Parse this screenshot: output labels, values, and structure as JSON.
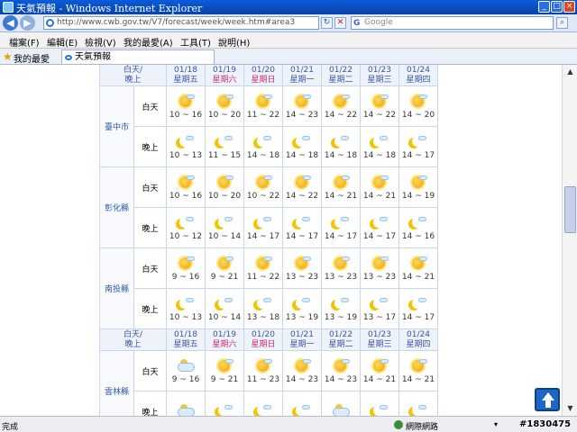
{
  "window": {
    "title": "天氣預報 - Windows Internet Explorer",
    "minimize": "_",
    "maximize": "□",
    "close": "×"
  },
  "address": {
    "url": "http://www.cwb.gov.tw/V7/forecast/week/week.htm#area3",
    "search_placeholder": "Google",
    "search_brand": "G"
  },
  "menu": [
    "檔案(F)",
    "編輯(E)",
    "檢視(V)",
    "我的最愛(A)",
    "工具(T)",
    "說明(H)"
  ],
  "favorites": {
    "label": "我的最愛",
    "tab": "天氣預報"
  },
  "table": {
    "corner_label": [
      "白天/",
      "晚上"
    ],
    "header": [
      {
        "date": "01/18",
        "weekday": "星期五",
        "weekend": false
      },
      {
        "date": "01/19",
        "weekday": "星期六",
        "weekend": true
      },
      {
        "date": "01/20",
        "weekday": "星期日",
        "weekend": true
      },
      {
        "date": "01/21",
        "weekday": "星期一",
        "weekend": false
      },
      {
        "date": "01/22",
        "weekday": "星期二",
        "weekend": false
      },
      {
        "date": "01/23",
        "weekday": "星期三",
        "weekend": false
      },
      {
        "date": "01/24",
        "weekday": "星期四",
        "weekend": false
      }
    ],
    "periods": {
      "day": "白天",
      "night": "晚上"
    },
    "cities": [
      {
        "name": "臺中市",
        "day": [
          {
            "icon": "sun-icon",
            "temp": "10 ~ 16"
          },
          {
            "icon": "sun-icon",
            "temp": "10 ~ 20"
          },
          {
            "icon": "sun-icon",
            "temp": "11 ~ 22"
          },
          {
            "icon": "sun-icon",
            "temp": "14 ~ 23"
          },
          {
            "icon": "sun-icon",
            "temp": "14 ~ 22"
          },
          {
            "icon": "sun-icon",
            "temp": "14 ~ 22"
          },
          {
            "icon": "sun-icon",
            "temp": "14 ~ 20"
          }
        ],
        "night": [
          {
            "icon": "moon-icon",
            "temp": "10 ~ 13"
          },
          {
            "icon": "moon-icon",
            "temp": "11 ~ 15"
          },
          {
            "icon": "moon-icon",
            "temp": "14 ~ 18"
          },
          {
            "icon": "moon-icon",
            "temp": "14 ~ 18"
          },
          {
            "icon": "moon-icon",
            "temp": "14 ~ 18"
          },
          {
            "icon": "moon-icon",
            "temp": "14 ~ 18"
          },
          {
            "icon": "moon-icon",
            "temp": "14 ~ 17"
          }
        ]
      },
      {
        "name": "彰化縣",
        "day": [
          {
            "icon": "sun-icon",
            "temp": "10 ~ 16"
          },
          {
            "icon": "sun-icon",
            "temp": "10 ~ 20"
          },
          {
            "icon": "sun-icon",
            "temp": "10 ~ 22"
          },
          {
            "icon": "sun-icon",
            "temp": "14 ~ 22"
          },
          {
            "icon": "sun-icon",
            "temp": "14 ~ 21"
          },
          {
            "icon": "sun-icon",
            "temp": "14 ~ 21"
          },
          {
            "icon": "sun-icon",
            "temp": "14 ~ 19"
          }
        ],
        "night": [
          {
            "icon": "moon-icon",
            "temp": "10 ~ 12"
          },
          {
            "icon": "moon-icon",
            "temp": "10 ~ 14"
          },
          {
            "icon": "moon-icon",
            "temp": "14 ~ 17"
          },
          {
            "icon": "moon-icon",
            "temp": "14 ~ 17"
          },
          {
            "icon": "moon-icon",
            "temp": "14 ~ 17"
          },
          {
            "icon": "moon-icon",
            "temp": "14 ~ 17"
          },
          {
            "icon": "moon-icon",
            "temp": "14 ~ 16"
          }
        ]
      },
      {
        "name": "南投縣",
        "day": [
          {
            "icon": "sun-icon",
            "temp": "9 ~ 16"
          },
          {
            "icon": "sun-icon",
            "temp": "9 ~ 21"
          },
          {
            "icon": "sun-icon",
            "temp": "11 ~ 22"
          },
          {
            "icon": "sun-icon",
            "temp": "13 ~ 23"
          },
          {
            "icon": "sun-icon",
            "temp": "13 ~ 23"
          },
          {
            "icon": "sun-icon",
            "temp": "13 ~ 23"
          },
          {
            "icon": "sun-icon",
            "temp": "14 ~ 21"
          }
        ],
        "night": [
          {
            "icon": "moon-icon",
            "temp": "10 ~ 13"
          },
          {
            "icon": "moon-icon",
            "temp": "10 ~ 14"
          },
          {
            "icon": "moon-icon",
            "temp": "13 ~ 18"
          },
          {
            "icon": "moon-icon",
            "temp": "13 ~ 19"
          },
          {
            "icon": "moon-icon",
            "temp": "13 ~ 19"
          },
          {
            "icon": "moon-icon",
            "temp": "13 ~ 17"
          },
          {
            "icon": "moon-icon",
            "temp": "14 ~ 17"
          }
        ]
      },
      {
        "name": "雲林縣",
        "day": [
          {
            "icon": "cloud-icon",
            "temp": "9 ~ 16"
          },
          {
            "icon": "sun-icon",
            "temp": "9 ~ 21"
          },
          {
            "icon": "sun-icon",
            "temp": "11 ~ 23"
          },
          {
            "icon": "sun-icon",
            "temp": "14 ~ 23"
          },
          {
            "icon": "sun-icon",
            "temp": "14 ~ 23"
          },
          {
            "icon": "sun-icon",
            "temp": "14 ~ 21"
          },
          {
            "icon": "sun-icon",
            "temp": "14 ~ 21"
          }
        ],
        "night": [
          {
            "icon": "cloud-icon",
            "temp": ""
          },
          {
            "icon": "moon-icon",
            "temp": ""
          },
          {
            "icon": "moon-icon",
            "temp": ""
          },
          {
            "icon": "moon-icon",
            "temp": ""
          },
          {
            "icon": "cloud-icon",
            "temp": ""
          },
          {
            "icon": "moon-icon",
            "temp": ""
          },
          {
            "icon": "moon-icon",
            "temp": ""
          }
        ]
      }
    ]
  },
  "status": {
    "text": "完成",
    "zone": "網際網路",
    "zoom": "▾",
    "watermark": "#1830475"
  },
  "colors": {
    "header_text": "#3a53a4",
    "weekend_text": "#cc2a72",
    "city_text": "#2b57a8"
  }
}
